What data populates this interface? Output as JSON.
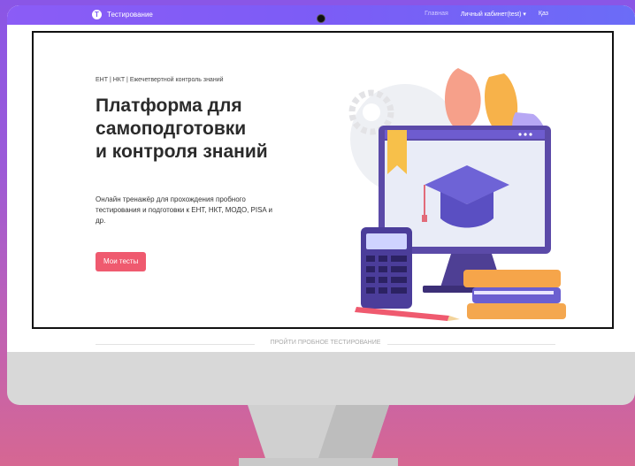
{
  "navbar": {
    "brand": "Тестирование",
    "logo_glyph": "Т",
    "links": {
      "home": "Главная",
      "cabinet": "Личный кабинет(test) ▾",
      "lang": "Қаз"
    }
  },
  "hero": {
    "eyebrow": "ЕНТ | НКТ | Ежечетвертной контроль знаний",
    "headline": [
      "Платформа для",
      "самоподготовки",
      "и контроля знаний"
    ],
    "description": "Онлайн тренажёр для прохождения пробного тестирования и подготовки к ЕНТ, НКТ, МОДО, PISA и др.",
    "cta_label": "Мои тесты"
  },
  "divider_label": "ПРОЙТИ ПРОБНОЕ ТЕСТИРОВАНИЕ",
  "colors": {
    "nav_start": "#8b5cf6",
    "nav_end": "#6b6cf7",
    "cta": "#ef5a6f",
    "background_top": "#8a56e6",
    "background_bottom": "#d66792"
  },
  "icons": [
    "logo-icon",
    "graduation-cap-icon",
    "calculator-icon",
    "pencil-icon",
    "books-icon",
    "bookmark-icon",
    "gear-icon"
  ]
}
